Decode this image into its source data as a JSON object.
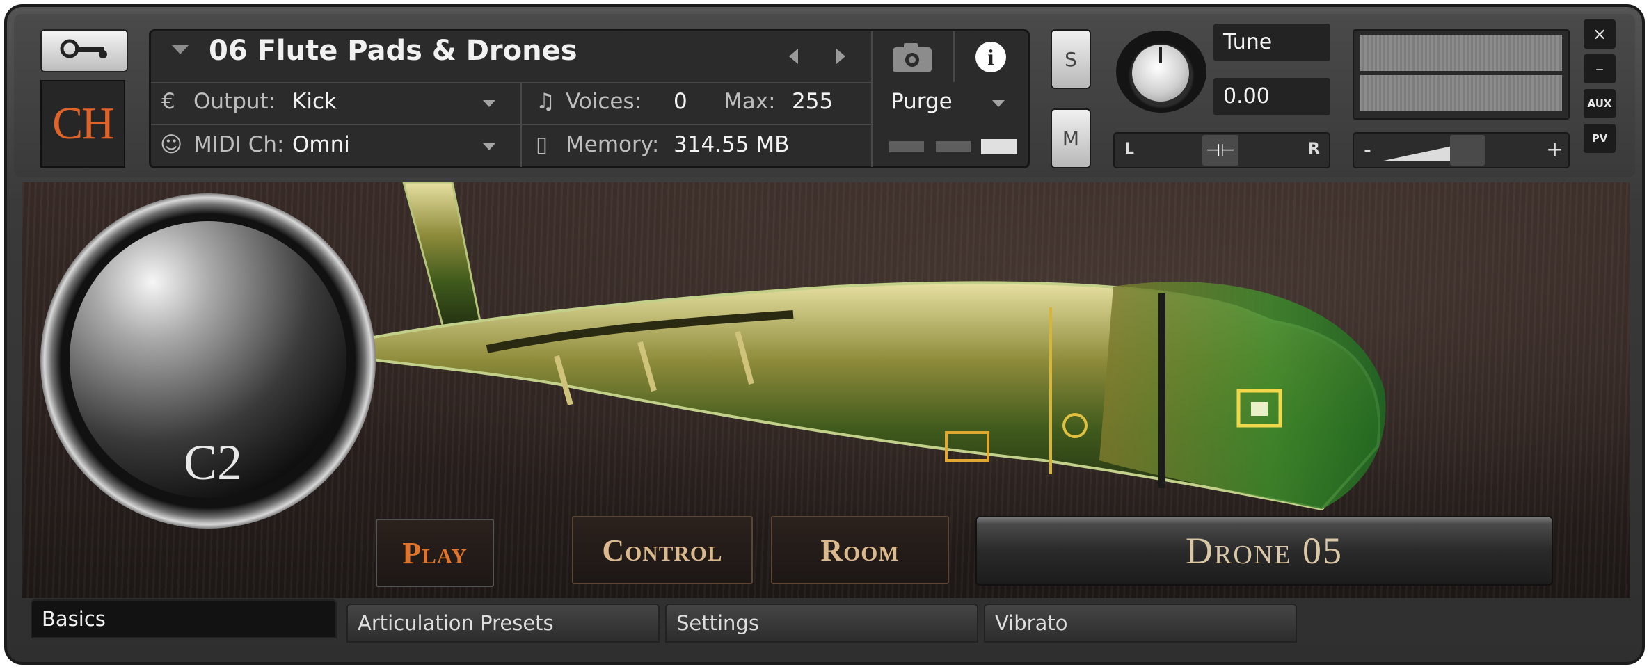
{
  "header": {
    "logo_text": "CH",
    "instrument_name": "06 Flute Pads & Drones",
    "output_label": "Output:",
    "output_value": "Kick",
    "voices_label": "Voices:",
    "voices_value": "0",
    "max_label": "Max:",
    "max_value": "255",
    "purge_label": "Purge",
    "midi_label": "MIDI Ch:",
    "midi_value": "Omni",
    "memory_label": "Memory:",
    "memory_value": "314.55 MB",
    "solo_label": "S",
    "mute_label": "M",
    "tune_label": "Tune",
    "tune_value": "0.00",
    "pan_left": "L",
    "pan_right": "R",
    "vol_minus": "-",
    "vol_plus": "+",
    "close_label": "×",
    "minimize_label": "–",
    "aux_label": "AUX",
    "pv_label": "PV"
  },
  "instrument": {
    "note_label": "C2",
    "buttons": [
      {
        "label": "Play",
        "color": "#e0742b"
      },
      {
        "label": "Control",
        "color": "#d9b98d"
      },
      {
        "label": "Room",
        "color": "#d9b98d"
      }
    ],
    "preset_display": "Drone 05"
  },
  "bottom_tabs": [
    {
      "label": "Basics",
      "active": true
    },
    {
      "label": "Articulation Presets",
      "active": false
    },
    {
      "label": "Settings",
      "active": false
    },
    {
      "label": "Vibrato",
      "active": false
    }
  ],
  "colors": {
    "accent": "#e0642a",
    "panel": "#2b2b2b"
  }
}
